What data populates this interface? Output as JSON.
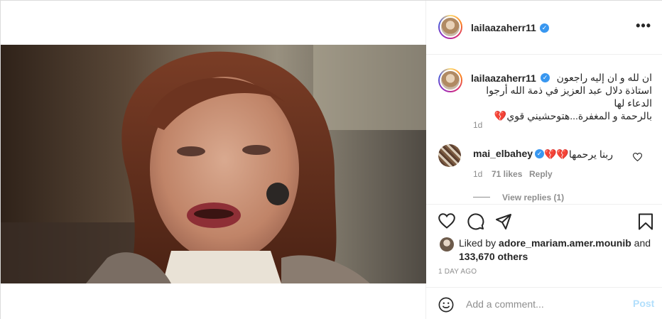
{
  "post": {
    "username": "lailaazaherr11",
    "image_alt": "Portrait photo of a smiling woman with auburn hair"
  },
  "header": {
    "more_icon": "more-horizontal-icon",
    "more_glyph": "•••"
  },
  "caption": {
    "username": "lailaazaherr11",
    "line1": "ان لله و ان إليه راجعون",
    "line2": "استاذة دلال عبد العزيز في ذمة الله أرجوا الدعاء لها",
    "line3": "بالرحمة و المغفرة...هتوحشيني قوي💔",
    "time": "1d"
  },
  "comment": {
    "username": "mai_elbahey",
    "text": "ربنا يرحمها💔💔",
    "time": "1d",
    "likes": "71 likes",
    "reply_label": "Reply",
    "view_replies": "View replies (1)"
  },
  "likes": {
    "prefix": "Liked by ",
    "liker": "adore_mariam.amer.mounib",
    "and": " and",
    "count": "133,670 others"
  },
  "post_time": "1 DAY AGO",
  "add_comment": {
    "placeholder": "Add a comment...",
    "post_label": "Post"
  },
  "colors": {
    "verified": "#3897f0",
    "post_disabled": "#b2dffc",
    "muted": "#8e8e8e"
  }
}
